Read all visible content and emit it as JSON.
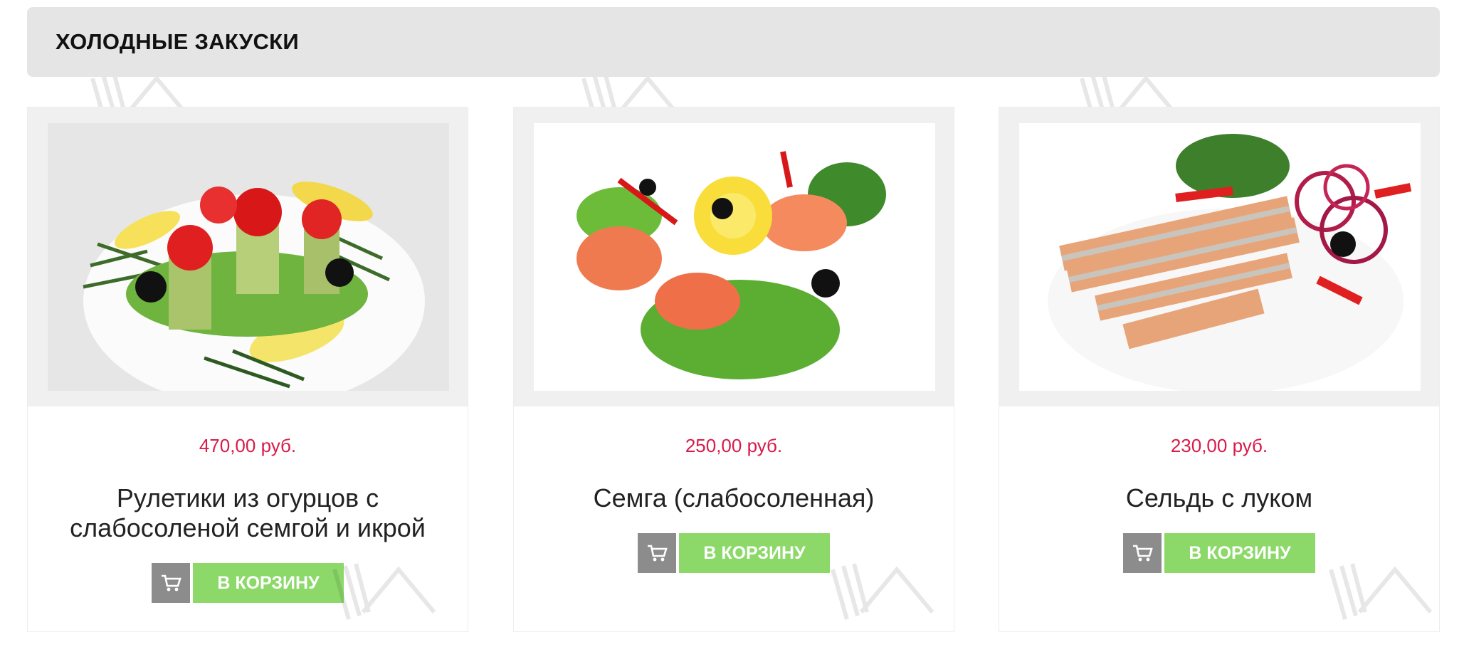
{
  "section": {
    "title": "ХОЛОДНЫЕ ЗАКУСКИ"
  },
  "products": [
    {
      "price": "470,00 руб.",
      "name": "Рулетики из огурцов с слабосоленой семгой и икрой",
      "cart_label": "В КОРЗИНУ",
      "image": "cucumber-salmon-rolls-with-caviar"
    },
    {
      "price": "250,00 руб.",
      "name": "Семга (слабосоленная)",
      "cart_label": "В КОРЗИНУ",
      "image": "lightly-salted-salmon-roses"
    },
    {
      "price": "230,00 руб.",
      "name": "Сельдь с луком",
      "cart_label": "В КОРЗИНУ",
      "image": "herring-with-onion"
    }
  ],
  "icons": {
    "cart": "shopping-cart-icon",
    "watermark": "fork-star-watermark-icon"
  },
  "colors": {
    "price": "#d81b4a",
    "cart_button": "#8cd96a",
    "cart_icon_bg": "#8c8c8c",
    "header_bg": "#e5e5e5"
  }
}
